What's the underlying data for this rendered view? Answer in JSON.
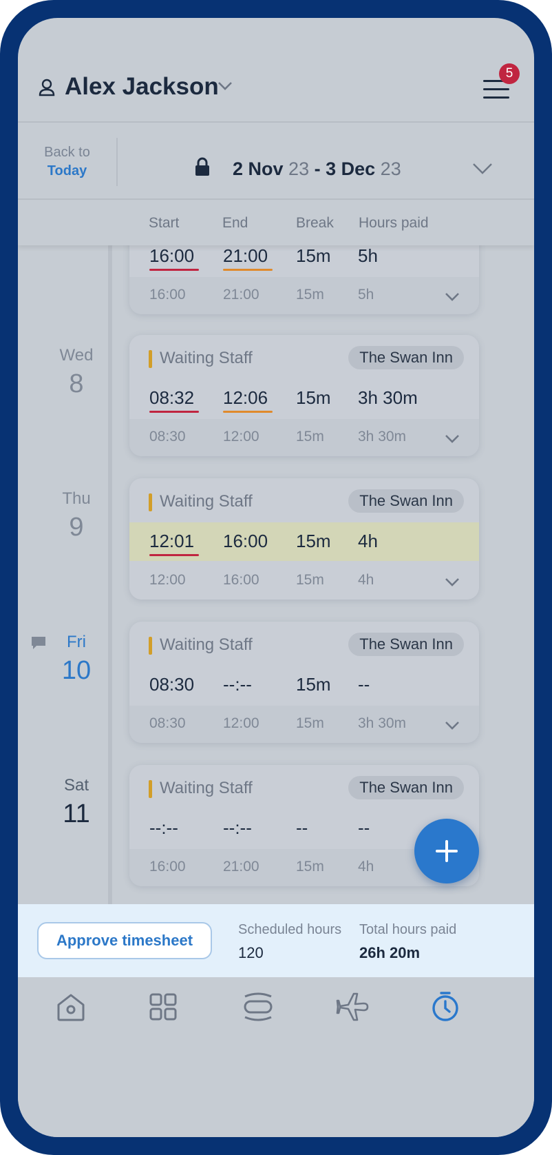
{
  "header": {
    "user_name": "Alex Jackson",
    "notification_count": "5"
  },
  "datebar": {
    "back_label": "Back to",
    "today_label": "Today",
    "range_start": "2 Nov",
    "range_start_year": "23",
    "range_sep": " - ",
    "range_end": "3 Dec",
    "range_end_year": "23"
  },
  "columns": {
    "start": "Start",
    "end": "End",
    "break": "Break",
    "hours": "Hours paid"
  },
  "days": [
    {
      "name": "",
      "num": "",
      "role": "",
      "venue": "",
      "actual": {
        "start": "16:00",
        "end": "21:00",
        "break": "15m",
        "hours": "5h"
      },
      "scheduled": {
        "start": "16:00",
        "end": "21:00",
        "break": "15m",
        "hours": "5h"
      }
    },
    {
      "name": "Wed",
      "num": "8",
      "role": "Waiting Staff",
      "venue": "The Swan Inn",
      "actual": {
        "start": "08:32",
        "end": "12:06",
        "break": "15m",
        "hours": "3h 30m"
      },
      "scheduled": {
        "start": "08:30",
        "end": "12:00",
        "break": "15m",
        "hours": "3h 30m"
      }
    },
    {
      "name": "Thu",
      "num": "9",
      "role": "Waiting Staff",
      "venue": "The Swan Inn",
      "actual": {
        "start": "12:01",
        "end": "16:00",
        "break": "15m",
        "hours": "4h"
      },
      "scheduled": {
        "start": "12:00",
        "end": "16:00",
        "break": "15m",
        "hours": "4h"
      }
    },
    {
      "name": "Fri",
      "num": "10",
      "role": "Waiting Staff",
      "venue": "The Swan Inn",
      "actual": {
        "start": "08:30",
        "end": "--:--",
        "break": "15m",
        "hours": "--"
      },
      "scheduled": {
        "start": "08:30",
        "end": "12:00",
        "break": "15m",
        "hours": "3h 30m"
      }
    },
    {
      "name": "Sat",
      "num": "11",
      "role": "Waiting Staff",
      "venue": "The Swan Inn",
      "actual": {
        "start": "--:--",
        "end": "--:--",
        "break": "--",
        "hours": "--"
      },
      "scheduled": {
        "start": "16:00",
        "end": "21:00",
        "break": "15m",
        "hours": "4h"
      }
    }
  ],
  "footer": {
    "approve_label": "Approve timesheet",
    "scheduled_label": "Scheduled hours",
    "scheduled_value": "120",
    "total_label": "Total hours paid",
    "total_value": "26h 20m"
  },
  "tabs": [
    "home-icon",
    "grid-icon",
    "shifts-icon",
    "plane-icon",
    "clock-icon"
  ],
  "colors": {
    "accent": "#2c78c8",
    "late": "#c02540",
    "early": "#e08a2c",
    "role": "#d29e29"
  }
}
